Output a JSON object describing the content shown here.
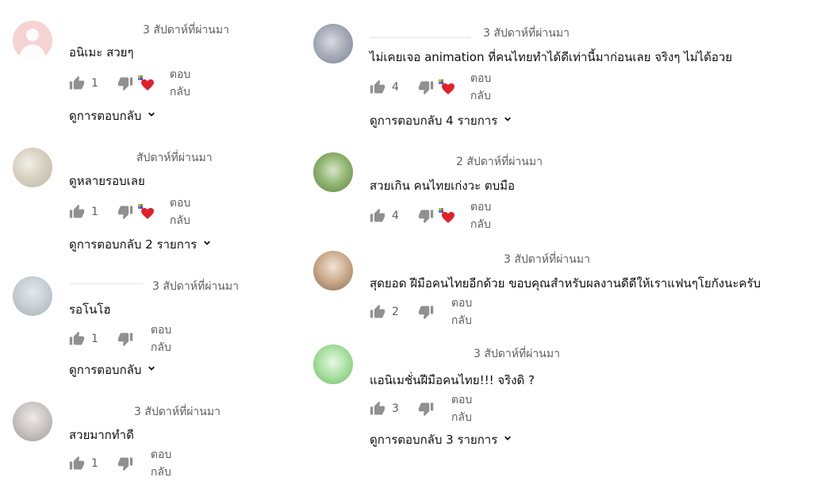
{
  "comments": [
    {
      "time": "3 สัปดาห์ที่ผ่านมา",
      "text": "อนิเมะ สวยๆ",
      "likes": "1",
      "reply_label": "ตอบกลับ",
      "view_replies": "ดูการตอบกลับ"
    },
    {
      "time": "สัปดาห์ที่ผ่านมา",
      "text": "ดูหลายรอบเลย",
      "likes": "1",
      "reply_label": "ตอบกลับ",
      "view_replies": "ดูการตอบกลับ 2 รายการ"
    },
    {
      "time": "3 สัปดาห์ที่ผ่านมา",
      "text": "รอโนโฮ",
      "likes": "1",
      "reply_label": "ตอบกลับ",
      "view_replies": "ดูการตอบกลับ"
    },
    {
      "time": "3 สัปดาห์ที่ผ่านมา",
      "text": "สวยมากทำดี",
      "likes": "1",
      "reply_label": "ตอบกลับ"
    },
    {
      "time": "3 สัปดาห์ที่ผ่านมา",
      "text": "ไม่เคยเจอ animation ที่คนไทยทำได้ดีเท่านี้มาก่อนเลย จริงๆ ไม่ได้อวย",
      "likes": "4",
      "reply_label": "ตอบกลับ",
      "view_replies": "ดูการตอบกลับ 4 รายการ"
    },
    {
      "time": "2 สัปดาห์ที่ผ่านมา",
      "text": "สวยเกิน คนไทยเก่งวะ ตบมือ",
      "likes": "4",
      "reply_label": "ตอบกลับ"
    },
    {
      "time": "3 สัปดาห์ที่ผ่านมา",
      "text": "สุดยอด ฝีมือคนไทยอีกด้วย ขอบคุณสำหรับผลงานดีดีให้เราแฟนๆโยกังนะครับ",
      "likes": "2",
      "reply_label": "ตอบกลับ"
    },
    {
      "time": "3 สัปดาห์ที่ผ่านมา",
      "text": "แอนิเมชั่นฝีมือคนไทย!!! จริงดิ ?",
      "likes": "3",
      "reply_label": "ตอบกลับ",
      "view_replies": "ดูการตอบกลับ 3 รายการ"
    }
  ],
  "colors": {
    "heart": "#e0202a",
    "text": "#0f0f0f",
    "muted": "#606060"
  },
  "icons": {
    "like": "thumbs-up-icon",
    "dislike": "thumbs-down-icon",
    "heart": "creator-heart-icon",
    "chevron": "chevron-down-icon"
  }
}
